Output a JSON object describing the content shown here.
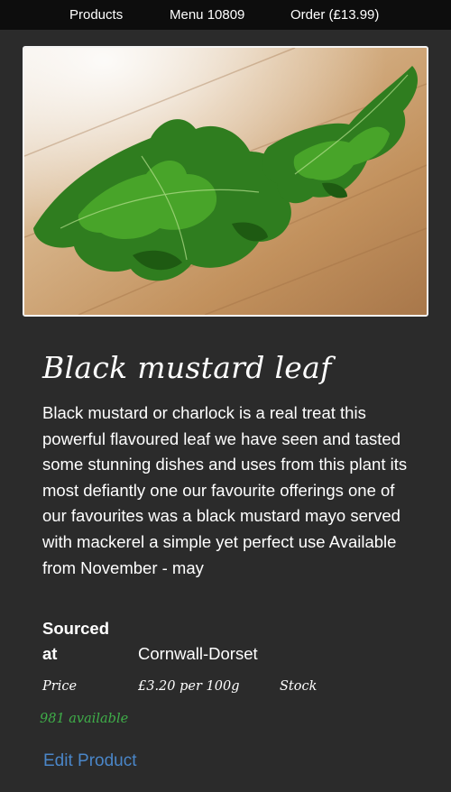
{
  "nav": {
    "products": "Products",
    "menu": "Menu 10809",
    "order": "Order (£13.99)"
  },
  "product": {
    "title": "Black mustard leaf",
    "description": "Black mustard or charlock is a real treat this powerful flavoured leaf we have seen and tasted some stunning dishes and uses from this plant its most defiantly one our favourite offerings one of our favourites was a black mustard mayo served with mackerel a simple yet perfect use Available from November - may",
    "sourced_label": "Sourced at",
    "sourced_value": "Cornwall-Dorset",
    "price_label": "Price",
    "price_value": "£3.20 per 100g",
    "stock_label": "Stock",
    "available": "981 available",
    "edit_label": "Edit Product"
  },
  "colors": {
    "page_bg": "#2b2b2b",
    "nav_bg": "#0d0d0d",
    "available": "#3fae49",
    "link": "#4a86c8"
  },
  "icons": {
    "product_image": "leafy-greens-on-wooden-table"
  }
}
